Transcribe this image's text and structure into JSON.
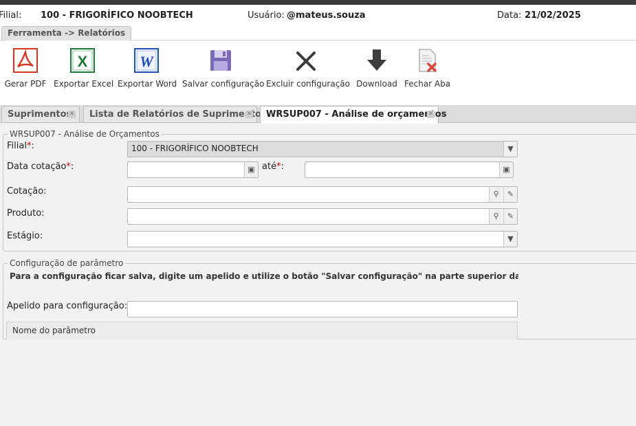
{
  "header": {
    "filial_label": "Filial:",
    "filial_value": "100 - FRIGORÍFICO NOOBTECH",
    "usuario_label": "Usuário:",
    "usuario_value": "@mateus.souza",
    "data_label": "Data:",
    "data_value": "21/02/2025"
  },
  "breadcrumb": "Ferramenta -> Relatórios",
  "toolbar": {
    "gerar_pdf": "Gerar PDF",
    "exportar_excel": "Exportar Excel",
    "exportar_word": "Exportar Word",
    "salvar_configuracao": "Salvar configuração",
    "excluir_configuracao": "Excluir configuração",
    "download": "Download",
    "fechar_aba": "Fechar Aba"
  },
  "tabs": [
    {
      "label": "Suprimentos"
    },
    {
      "label": "Lista de Relatórios de Suprimentos"
    },
    {
      "label": "WRSUP007 - Análise de orçamentos"
    }
  ],
  "form": {
    "legend": "WRSUP007 - Análise de Orçamentos",
    "filial_label": "Filial",
    "filial_value": "100 - FRIGORÍFICO NOOBTECH",
    "data_cotacao_label": "Data cotação",
    "ate_label": "até",
    "data_cotacao_value": "",
    "ate_value": "",
    "cotacao_label": "Cotação:",
    "cotacao_value": "",
    "produto_label": "Produto:",
    "produto_value": "",
    "estagio_label": "Estágio:",
    "estagio_value": ""
  },
  "config": {
    "legend": "Configuração de parâmetro",
    "note": "Para a configuração ficar salva, digite um apelido e utilize o botão \"Salvar configuração\" na parte superior da tela. O ap",
    "apelido_label": "Apelido para configuração:",
    "apelido_value": "",
    "grid_header": "Nome do parâmetro"
  },
  "colors": {
    "pdf_red": "#d9351f",
    "excel_green": "#1e7a3a",
    "word_blue": "#1f4fb4",
    "save_purple": "#7a6bb8",
    "required": "#d40000"
  }
}
